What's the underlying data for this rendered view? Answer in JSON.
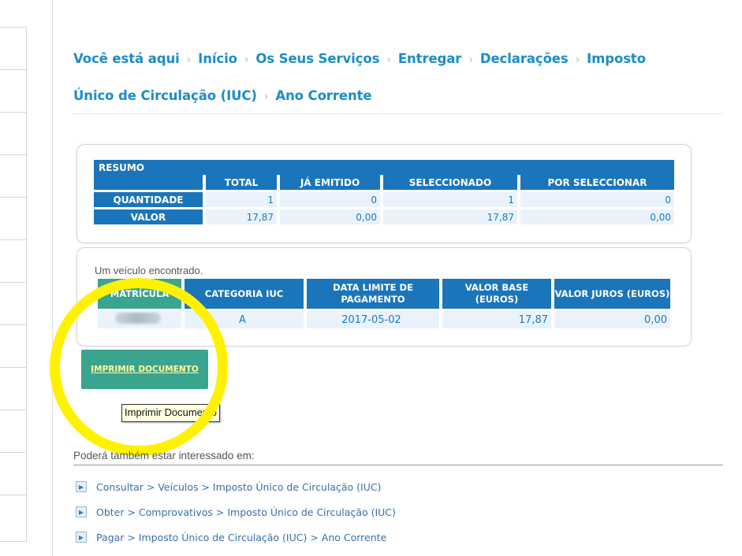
{
  "breadcrumb": {
    "items": [
      "Você está aqui",
      "Início",
      "Os Seus Serviços",
      "Entregar",
      "Declarações",
      "Imposto",
      "Único de Circulação (IUC)",
      "Ano Corrente"
    ],
    "separator": "›"
  },
  "summary": {
    "title": "RESUMO",
    "headers": [
      "TOTAL",
      "JÁ EMITIDO",
      "SELECCIONADO",
      "POR SELECCIONAR"
    ],
    "rows": [
      {
        "label": "QUANTIDADE",
        "values": [
          "1",
          "0",
          "1",
          "0"
        ]
      },
      {
        "label": "VALOR",
        "values": [
          "17,87",
          "0,00",
          "17,87",
          "0,00"
        ]
      }
    ]
  },
  "vehicles": {
    "found_text": "Um veículo encontrado.",
    "headers": [
      "MATRÍCULA",
      "CATEGORIA IUC",
      "DATA LIMITE DE PAGAMENTO",
      "VALOR BASE (EUROS)",
      "VALOR JUROS (EUROS)"
    ],
    "row": {
      "categoria": "A",
      "data_limite": "2017-05-02",
      "valor_base": "17,87",
      "valor_juros": "0,00"
    }
  },
  "print_button": {
    "label": "IMPRIMIR DOCUMENTO",
    "tooltip": "Imprimir Documento"
  },
  "related": {
    "title": "Poderá também estar interessado em:",
    "links": [
      "Consultar > Veículos > Imposto Único de Circulação (IUC)",
      "Obter > Comprovativos > Imposto Único de Circulação (IUC)",
      "Pagar > Imposto Único de Circulação (IUC) > Ano Corrente"
    ]
  },
  "colors": {
    "link_blue": "#1a8dc9",
    "table_header": "#1b75bb",
    "button_green": "#3aa48f",
    "highlight": "#fff200"
  },
  "icons": {
    "link_bullet": "play-arrow-icon"
  }
}
